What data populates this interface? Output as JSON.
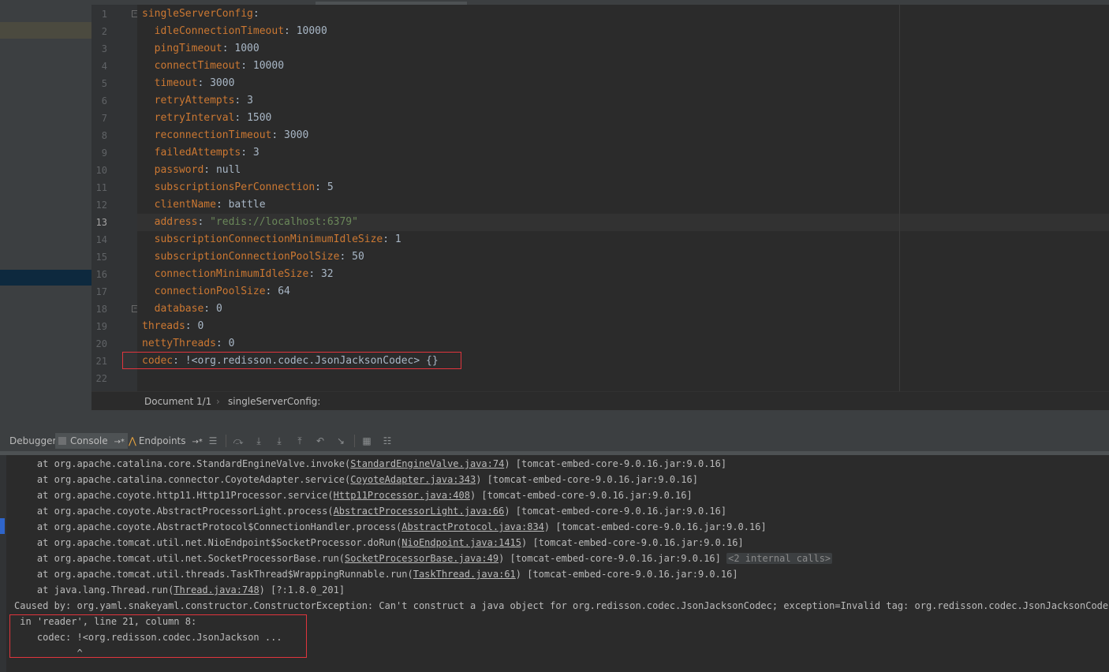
{
  "editor": {
    "lines": [
      {
        "num": "1",
        "indent": "",
        "key": "singleServerConfig",
        "sep": ":",
        "value": ""
      },
      {
        "num": "2",
        "indent": "  ",
        "key": "idleConnectionTimeout",
        "sep": ": ",
        "value": "10000"
      },
      {
        "num": "3",
        "indent": "  ",
        "key": "pingTimeout",
        "sep": ": ",
        "value": "1000"
      },
      {
        "num": "4",
        "indent": "  ",
        "key": "connectTimeout",
        "sep": ": ",
        "value": "10000"
      },
      {
        "num": "5",
        "indent": "  ",
        "key": "timeout",
        "sep": ": ",
        "value": "3000"
      },
      {
        "num": "6",
        "indent": "  ",
        "key": "retryAttempts",
        "sep": ": ",
        "value": "3"
      },
      {
        "num": "7",
        "indent": "  ",
        "key": "retryInterval",
        "sep": ": ",
        "value": "1500"
      },
      {
        "num": "8",
        "indent": "  ",
        "key": "reconnectionTimeout",
        "sep": ": ",
        "value": "3000"
      },
      {
        "num": "9",
        "indent": "  ",
        "key": "failedAttempts",
        "sep": ": ",
        "value": "3"
      },
      {
        "num": "10",
        "indent": "  ",
        "key": "password",
        "sep": ": ",
        "value": "null"
      },
      {
        "num": "11",
        "indent": "  ",
        "key": "subscriptionsPerConnection",
        "sep": ": ",
        "value": "5"
      },
      {
        "num": "12",
        "indent": "  ",
        "key": "clientName",
        "sep": ": ",
        "value": "battle"
      },
      {
        "num": "13",
        "indent": "  ",
        "key": "address",
        "sep": ": ",
        "value": "\"redis://localhost:6379\""
      },
      {
        "num": "14",
        "indent": "  ",
        "key": "subscriptionConnectionMinimumIdleSize",
        "sep": ": ",
        "value": "1"
      },
      {
        "num": "15",
        "indent": "  ",
        "key": "subscriptionConnectionPoolSize",
        "sep": ": ",
        "value": "50"
      },
      {
        "num": "16",
        "indent": "  ",
        "key": "connectionMinimumIdleSize",
        "sep": ": ",
        "value": "32"
      },
      {
        "num": "17",
        "indent": "  ",
        "key": "connectionPoolSize",
        "sep": ": ",
        "value": "64"
      },
      {
        "num": "18",
        "indent": "  ",
        "key": "database",
        "sep": ": ",
        "value": "0"
      },
      {
        "num": "19",
        "indent": "",
        "key": "threads",
        "sep": ": ",
        "value": "0"
      },
      {
        "num": "20",
        "indent": "",
        "key": "nettyThreads",
        "sep": ": ",
        "value": "0"
      },
      {
        "num": "21",
        "indent": "",
        "key": "codec",
        "sep": ": ",
        "value": "!<org.redisson.codec.JsonJacksonCodec> {}"
      },
      {
        "num": "22",
        "indent": "",
        "key": "",
        "sep": "",
        "value": ""
      }
    ],
    "current_line": "13"
  },
  "breadcrumb": {
    "document": "Document 1/1",
    "separator": "›",
    "path": "singleServerConfig:"
  },
  "tool_window": {
    "tabs": {
      "debugger": "Debugger",
      "console": "Console",
      "console_pin": "→*",
      "endpoints": "Endpoints",
      "endpoints_pin": "→*"
    }
  },
  "console": {
    "lines": [
      {
        "prefix": "    at org.apache.catalina.core.StandardEngineValve.invoke(",
        "link": "StandardEngineValve.java:74",
        "suffix": ") [tomcat-embed-core-9.0.16.jar:9.0.16]",
        "fold": ""
      },
      {
        "prefix": "    at org.apache.catalina.connector.CoyoteAdapter.service(",
        "link": "CoyoteAdapter.java:343",
        "suffix": ") [tomcat-embed-core-9.0.16.jar:9.0.16]",
        "fold": ""
      },
      {
        "prefix": "    at org.apache.coyote.http11.Http11Processor.service(",
        "link": "Http11Processor.java:408",
        "suffix": ") [tomcat-embed-core-9.0.16.jar:9.0.16]",
        "fold": ""
      },
      {
        "prefix": "    at org.apache.coyote.AbstractProcessorLight.process(",
        "link": "AbstractProcessorLight.java:66",
        "suffix": ") [tomcat-embed-core-9.0.16.jar:9.0.16]",
        "fold": ""
      },
      {
        "prefix": "    at org.apache.coyote.AbstractProtocol$ConnectionHandler.process(",
        "link": "AbstractProtocol.java:834",
        "suffix": ") [tomcat-embed-core-9.0.16.jar:9.0.16]",
        "fold": ""
      },
      {
        "prefix": "    at org.apache.tomcat.util.net.NioEndpoint$SocketProcessor.doRun(",
        "link": "NioEndpoint.java:1415",
        "suffix": ") [tomcat-embed-core-9.0.16.jar:9.0.16]",
        "fold": ""
      },
      {
        "prefix": "    at org.apache.tomcat.util.net.SocketProcessorBase.run(",
        "link": "SocketProcessorBase.java:49",
        "suffix": ") [tomcat-embed-core-9.0.16.jar:9.0.16]",
        "fold": "<2 internal calls>"
      },
      {
        "prefix": "    at org.apache.tomcat.util.threads.TaskThread$WrappingRunnable.run(",
        "link": "TaskThread.java:61",
        "suffix": ") [tomcat-embed-core-9.0.16.jar:9.0.16]",
        "fold": ""
      },
      {
        "prefix": "    at java.lang.Thread.run(",
        "link": "Thread.java:748",
        "suffix": ") [?:1.8.0_201]",
        "fold": ""
      },
      {
        "prefix": "Caused by: org.yaml.snakeyaml.constructor.ConstructorException: Can't construct a java object for org.redisson.codec.JsonJacksonCodec; exception=Invalid tag: org.redisson.codec.JsonJacksonCodec",
        "link": "",
        "suffix": "",
        "fold": ""
      },
      {
        "prefix": " in 'reader', line 21, column 8:",
        "link": "",
        "suffix": "",
        "fold": ""
      },
      {
        "prefix": "    codec: !<org.redisson.codec.JsonJackson ...",
        "link": "",
        "suffix": "",
        "fold": ""
      },
      {
        "prefix": "           ^",
        "link": "",
        "suffix": "",
        "fold": ""
      }
    ]
  },
  "colors": {
    "editor_bg": "#2b2b2b",
    "yaml_key": "#cc7832",
    "yaml_string": "#6a8759",
    "highlight_box": "#e0353d"
  },
  "icons": {
    "tool_window": [
      "console-icon",
      "endpoints-icon",
      "menu-icon",
      "step-over-icon",
      "step-into-icon",
      "force-step-into-icon",
      "step-out-icon",
      "drop-frame-icon",
      "run-to-cursor-icon",
      "evaluate-icon",
      "trace-icon"
    ]
  }
}
